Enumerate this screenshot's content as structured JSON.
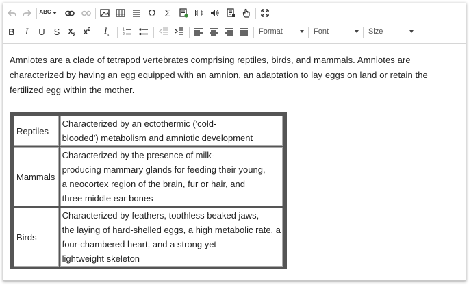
{
  "toolbar": {
    "format_label": "Format",
    "font_label": "Font",
    "size_label": "Size",
    "spellcheck_label": "ABC"
  },
  "content": {
    "paragraph": "Amniotes are a clade of tetrapod vertebrates comprising reptiles, birds, and mammals. Amniotes are characterized by having an egg equipped with an amnion, an adaptation to lay eggs on land or retain the fertilized egg within the mother.",
    "table": [
      {
        "name": "Reptiles",
        "lines": [
          "Characterized by an ectothermic ('cold-",
          "blooded') metabolism and amniotic development"
        ]
      },
      {
        "name": "Mammals",
        "lines": [
          "Characterized by the presence of milk-",
          "producing mammary glands for feeding their young,",
          "a neocortex region of the brain, fur or hair, and",
          "three middle ear bones"
        ]
      },
      {
        "name": "Birds",
        "lines": [
          "Characterized by feathers, toothless beaked jaws,",
          "the laying of hard-shelled eggs, a high metabolic rate, a",
          "four-chambered heart, and a strong yet",
          "lightweight skeleton"
        ]
      }
    ]
  },
  "colors": {
    "table_border": "#555555",
    "text": "#222222",
    "toolbar_disabled": "#b9b9b9"
  }
}
